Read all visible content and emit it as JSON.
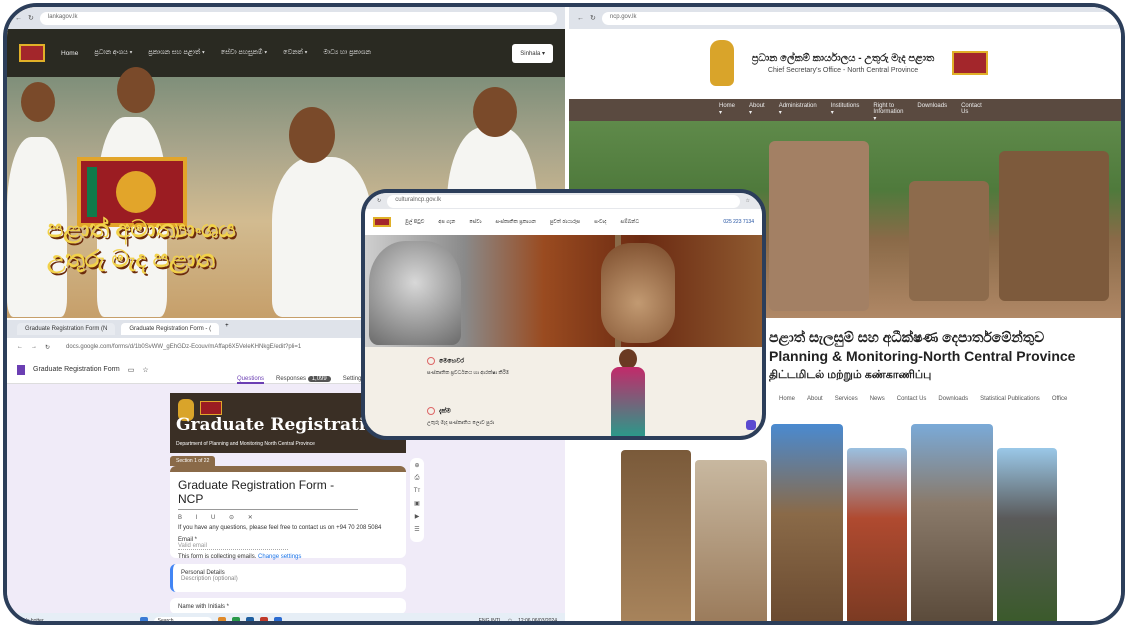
{
  "tl": {
    "address": "lankagov.lk",
    "nav": [
      "Home",
      "ප්‍රධාන අංශය ▾",
      "ප්‍රකාශන සහ පළාත් ▾",
      "සේවා පහසුකම් ▾",
      "වෙනත් ▾",
      "මාධ්‍ය හා ප්‍රකාශන"
    ],
    "lang": "Sinhala ▾",
    "hero": [
      "පළාත් අමාත්‍යාංශය",
      "උතුරු මැද පළාත"
    ]
  },
  "tr": {
    "address": "ncp.gov.lk",
    "title": "ප්‍රධාන ලේකම් කාර්යාලය - උතුරු මැද පළාත",
    "subtitle": "Chief Secretary's Office - North Central Province",
    "nav": [
      "Home ▾",
      "About ▾",
      "Administration ▾",
      "Institutions ▾",
      "Right to Information ▾",
      "Downloads",
      "Contact Us"
    ]
  },
  "bl": {
    "tabs": [
      "Graduate Registration Form (N",
      "Graduate Registration Form - (",
      "+"
    ],
    "address": "docs.google.com/forms/d/1b0SvWW_gEhGDz-Ecouv/mAffap6X5VeleKHNkgE/edit?pli=1",
    "doc_title": "Graduate Registration Form",
    "form_tabs": [
      "Questions",
      "Responses",
      "Settings"
    ],
    "responses_count": "1,099",
    "banner_title": "Graduate Registration",
    "banner_sub": "Department of Planning and Monitoring North Central Province",
    "section_label": "Section 1 of 22",
    "form_title": "Graduate Registration Form - NCP",
    "format_tools": "B I U ⊝ ✕",
    "help_text": "If you have any questions, please feel free to contact us on +94 70 208 5084",
    "email_label": "Email *",
    "email_hint": "Valid email",
    "collecting": "This form is collecting emails.",
    "change_settings": "Change settings",
    "personal": "Personal Details",
    "personal_desc": "Description (optional)",
    "name_label": "Name with Initials *",
    "taskbar_left": "Heads hotter",
    "search": "Search",
    "lang": "ENG INTL",
    "time": "12:06",
    "date": "06/03/2024"
  },
  "br": {
    "title_lines": [
      "පළාත් සැලසුම් සහ අධීක්ෂණ දෙපාර්තමේන්තුව",
      "Planning & Monitoring-North Central Province",
      "திட்டமிடல் மற்றும் கண்காணிப்பு"
    ],
    "nav": [
      "Home",
      "About",
      "Services",
      "News",
      "Contact Us",
      "Downloads",
      "Statistical Publications",
      "Office"
    ]
  },
  "center": {
    "address": "culturalncp.gov.lk",
    "nav": [
      "මුල් පිටුව",
      "අප ගැන",
      "සේවා",
      "සංස්කෘතික ප්‍රකාශන",
      "පුවත් ඡායාරූප",
      "සංවාද",
      "සම්බන්ධ"
    ],
    "phone": "025 223 7134",
    "items": [
      {
        "heading": "මෙහෙවර",
        "text": "සංස්කෘතික ප්‍රවර්ධනය හා ආරක්ෂා කිරීම"
      },
      {
        "heading": "දැක්ම",
        "text": "උතුරු මැද සංස්කෘතිය ලොව පුරා"
      }
    ]
  },
  "colors": {
    "frame": "#2c3e5a",
    "maroon": "#9b1c22",
    "gold": "#e2a52a",
    "purple": "#6b3fb3"
  }
}
